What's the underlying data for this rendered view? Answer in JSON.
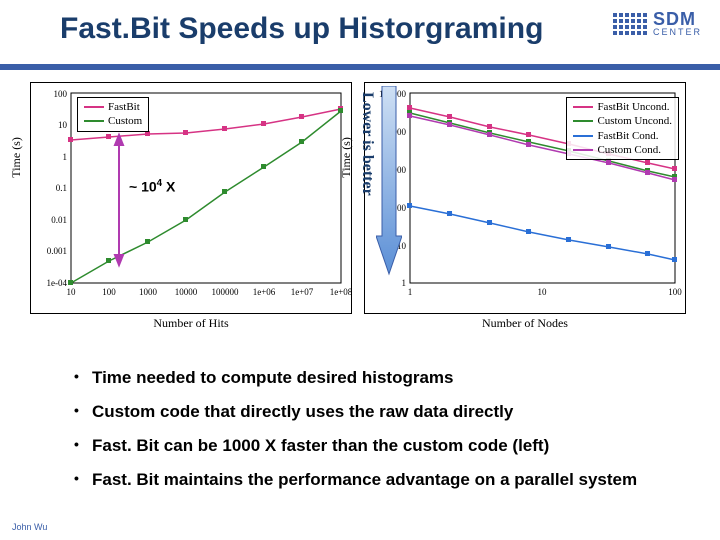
{
  "title": "Fast.Bit Speeds up Historgraming",
  "logo": {
    "line1": "SDM",
    "line2": "CENTER"
  },
  "footer": "John Wu",
  "annotation_x": "~ 10",
  "annotation_sup": "4",
  "annotation_suffix": " X",
  "vertical_note": "Lower is better",
  "bullets": [
    "Time needed to compute desired histograms",
    "Custom code that directly uses the raw data directly",
    "Fast. Bit can be 1000 X faster than the custom code (left)",
    "Fast. Bit maintains the performance advantage on a parallel system"
  ],
  "chart_data": [
    {
      "type": "line",
      "title": "",
      "xlabel": "Number of Hits",
      "ylabel": "Time (s)",
      "xscale": "log",
      "yscale": "log",
      "xlim": [
        10,
        100000000.0
      ],
      "ylim": [
        0.0001,
        100
      ],
      "series": [
        {
          "name": "FastBit",
          "color": "#d63384",
          "marker": "square",
          "x": [
            10,
            100,
            1000,
            10000,
            100000,
            1000000.0,
            10000000.0,
            100000000.0
          ],
          "y": [
            3,
            4,
            5,
            6,
            8,
            12,
            20,
            40
          ]
        },
        {
          "name": "Custom",
          "color": "#2e8b2e",
          "marker": "square",
          "x": [
            10,
            100,
            1000,
            10000,
            100000,
            1000000.0,
            10000000.0,
            100000000.0
          ],
          "y": [
            0.0001,
            0.0005,
            0.002,
            0.01,
            0.08,
            0.5,
            3,
            30
          ]
        }
      ],
      "legend_pos": "top-left",
      "arrow_annotation": {
        "x": 120,
        "y_top": 3,
        "y_bot": 0.0005,
        "label": "~ 10^4 X"
      }
    },
    {
      "type": "line",
      "title": "",
      "xlabel": "Number of Nodes",
      "ylabel": "Time (s)",
      "xscale": "log",
      "yscale": "log",
      "xlim": [
        1,
        100
      ],
      "ylim": [
        1,
        100000
      ],
      "series": [
        {
          "name": "FastBit Uncond.",
          "color": "#d63384",
          "marker": "square",
          "x": [
            1,
            2,
            4,
            8,
            16,
            32,
            64,
            100
          ],
          "y": [
            40000,
            22000,
            12000,
            7000,
            4000,
            2200,
            1300,
            900
          ]
        },
        {
          "name": "Custom Uncond.",
          "color": "#2e8b2e",
          "marker": "square",
          "x": [
            1,
            2,
            4,
            8,
            16,
            32,
            64,
            100
          ],
          "y": [
            30000,
            16000,
            9000,
            5000,
            2800,
            1600,
            900,
            600
          ]
        },
        {
          "name": "FastBit Cond.",
          "color": "#2a6fd6",
          "marker": "square",
          "x": [
            1,
            2,
            4,
            8,
            16,
            32,
            64,
            100
          ],
          "y": [
            120,
            70,
            40,
            24,
            14,
            9,
            6,
            4
          ]
        },
        {
          "name": "Custom Cond.",
          "color": "#b03ab0",
          "marker": "square",
          "x": [
            1,
            2,
            4,
            8,
            16,
            32,
            64,
            100
          ],
          "y": [
            22000,
            12000,
            6500,
            3600,
            2000,
            1200,
            700,
            450
          ]
        }
      ],
      "legend_pos": "top-right"
    }
  ]
}
